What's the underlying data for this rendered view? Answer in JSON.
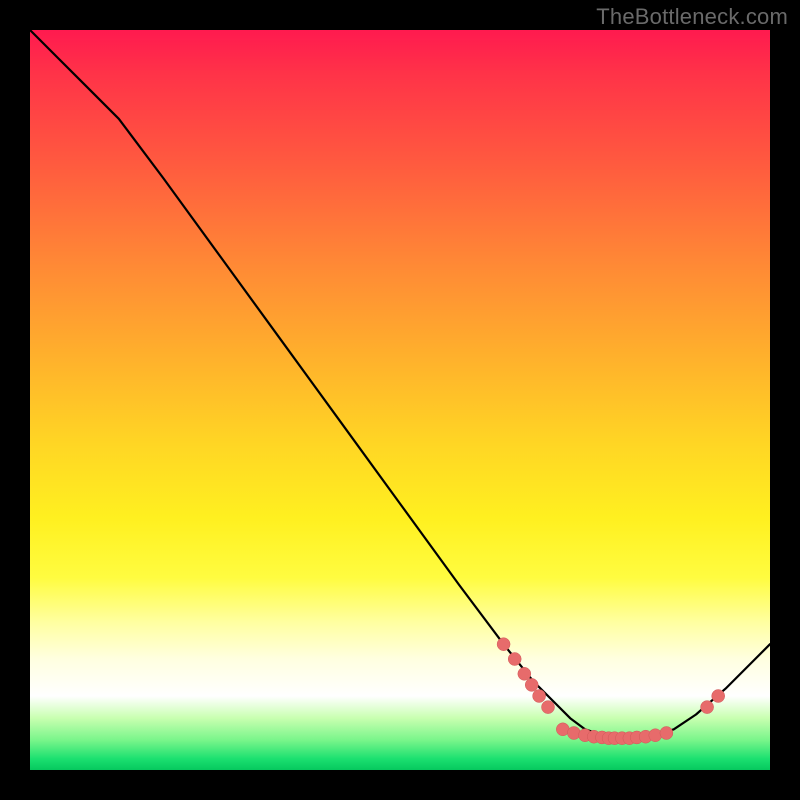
{
  "watermark": "TheBottleneck.com",
  "colors": {
    "dot_fill": "#e76b6b",
    "dot_stroke": "#d05858",
    "curve": "#000000",
    "frame_bg": "#000000"
  },
  "chart_data": {
    "type": "line",
    "title": "",
    "xlabel": "",
    "ylabel": "",
    "xlim": [
      0,
      100
    ],
    "ylim": [
      0,
      100
    ],
    "grid": false,
    "legend": false,
    "notes": "Vertical rainbow heat band from red at top to green at bottom; black curve drops from top-left, reaches a flat minimum near bottom around x≈75–83, then rises toward bottom-right. Coral dots cluster on the descending side of the valley and lightly on the rising side.",
    "series": [
      {
        "name": "curve",
        "x": [
          0,
          4,
          8,
          12,
          18,
          26,
          34,
          42,
          50,
          58,
          64,
          68,
          71,
          73,
          75,
          78,
          81,
          84,
          87,
          90,
          94,
          98,
          100
        ],
        "y": [
          100,
          96,
          92,
          88,
          80,
          69,
          58,
          47,
          36,
          25,
          17,
          12,
          9,
          7,
          5.5,
          4.5,
          4.2,
          4.5,
          5.5,
          7.5,
          11,
          15,
          17
        ]
      }
    ],
    "dots": [
      {
        "x": 64.0,
        "y": 17.0
      },
      {
        "x": 65.5,
        "y": 15.0
      },
      {
        "x": 66.8,
        "y": 13.0
      },
      {
        "x": 67.8,
        "y": 11.5
      },
      {
        "x": 68.8,
        "y": 10.0
      },
      {
        "x": 70.0,
        "y": 8.5
      },
      {
        "x": 72.0,
        "y": 5.5
      },
      {
        "x": 73.5,
        "y": 5.0
      },
      {
        "x": 75.0,
        "y": 4.7
      },
      {
        "x": 76.2,
        "y": 4.5
      },
      {
        "x": 77.3,
        "y": 4.4
      },
      {
        "x": 78.2,
        "y": 4.3
      },
      {
        "x": 79.0,
        "y": 4.3
      },
      {
        "x": 80.0,
        "y": 4.3
      },
      {
        "x": 81.0,
        "y": 4.3
      },
      {
        "x": 82.0,
        "y": 4.4
      },
      {
        "x": 83.2,
        "y": 4.5
      },
      {
        "x": 84.5,
        "y": 4.7
      },
      {
        "x": 86.0,
        "y": 5.0
      },
      {
        "x": 91.5,
        "y": 8.5
      },
      {
        "x": 93.0,
        "y": 10.0
      }
    ]
  }
}
